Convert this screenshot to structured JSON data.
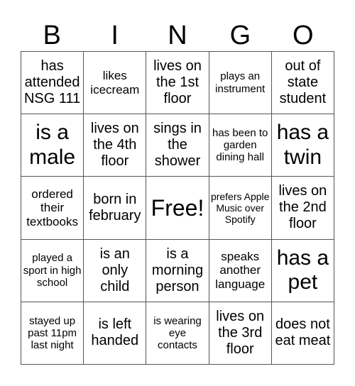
{
  "header": [
    "B",
    "I",
    "N",
    "G",
    "O"
  ],
  "cells": [
    "has attended NSG 111",
    "likes icecream",
    "lives on the 1st floor",
    "plays an instrument",
    "out of state student",
    "is a male",
    "lives on the 4th floor",
    "sings in the shower",
    "has been to garden dining hall",
    "has a twin",
    "ordered their textbooks",
    "born in february",
    "Free!",
    "prefers Apple Music over Spotify",
    "lives on the 2nd floor",
    "played a sport in high school",
    "is an only child",
    "is a morning person",
    "speaks another language",
    "has a pet",
    "stayed up past 11pm last night",
    "is left handed",
    "is wearing eye contacts",
    "lives on the 3rd floor",
    "does not eat meat"
  ]
}
